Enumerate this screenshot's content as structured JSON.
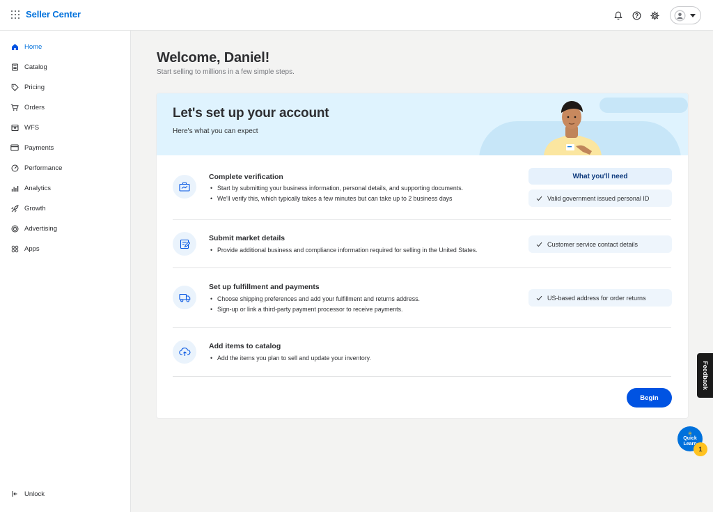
{
  "header": {
    "brand": "Seller Center",
    "icons": [
      "apps-grid-icon",
      "bell-icon",
      "help-icon",
      "gear-icon",
      "account-icon",
      "chevron-down-icon"
    ]
  },
  "sidebar": {
    "items": [
      {
        "label": "Home",
        "icon": "home-icon",
        "active": true
      },
      {
        "label": "Catalog",
        "icon": "catalog-icon"
      },
      {
        "label": "Pricing",
        "icon": "tag-icon"
      },
      {
        "label": "Orders",
        "icon": "cart-icon"
      },
      {
        "label": "WFS",
        "icon": "box-icon"
      },
      {
        "label": "Payments",
        "icon": "card-icon"
      },
      {
        "label": "Performance",
        "icon": "gauge-icon"
      },
      {
        "label": "Analytics",
        "icon": "bar-chart-icon"
      },
      {
        "label": "Growth",
        "icon": "rocket-icon"
      },
      {
        "label": "Advertising",
        "icon": "target-icon"
      },
      {
        "label": "Apps",
        "icon": "apps-icon"
      }
    ],
    "unlock_label": "Unlock"
  },
  "main": {
    "welcome": "Welcome, Daniel!",
    "subtitle": "Start selling to millions in a few simple steps."
  },
  "setup": {
    "title": "Let's set up your account",
    "subtitle": "Here's what you can expect",
    "need_title": "What you'll need",
    "steps": [
      {
        "title": "Complete verification",
        "icon": "briefcase-icon",
        "bullets": [
          "Start by submitting your business information, personal details, and supporting documents.",
          "We'll verify this, which typically takes a few minutes but can take up to 2 business days"
        ],
        "need": "Valid government issued personal ID"
      },
      {
        "title": "Submit market details",
        "icon": "edit-document-icon",
        "bullets": [
          "Provide additional business and compliance information required for selling in the United States."
        ],
        "need": "Customer service contact details"
      },
      {
        "title": "Set up fulfillment and payments",
        "icon": "truck-icon",
        "bullets": [
          "Choose shipping preferences and add your fulfillment and returns address.",
          "Sign-up or link a third-party payment processor to receive payments."
        ],
        "need": "US-based address for order returns"
      },
      {
        "title": "Add items to catalog",
        "icon": "cloud-upload-icon",
        "bullets": [
          "Add the items you plan to sell and update your inventory."
        ]
      }
    ],
    "begin_label": "Begin"
  },
  "feedback_label": "Feedback",
  "quick_learn": {
    "label_1": "Quick",
    "label_2": "Learn",
    "badge": "1"
  },
  "colors": {
    "brand": "#0071dc",
    "primary_button": "#0053e2",
    "banner": "#dff3fe",
    "badge": "#ffc220"
  }
}
